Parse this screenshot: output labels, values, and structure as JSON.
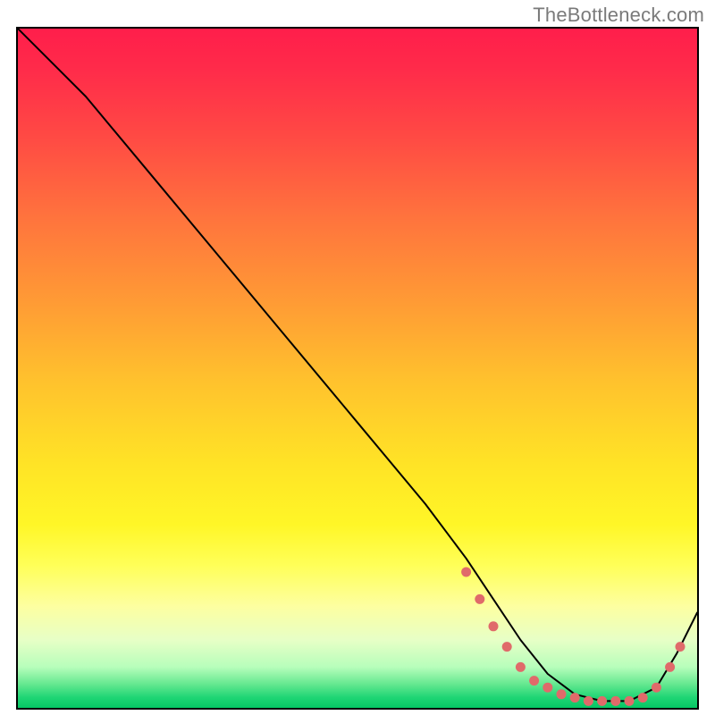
{
  "watermark": "TheBottleneck.com",
  "chart_data": {
    "type": "line",
    "title": "",
    "xlabel": "",
    "ylabel": "",
    "xlim": [
      0,
      100
    ],
    "ylim": [
      0,
      100
    ],
    "grid": false,
    "legend": false,
    "background_gradient": {
      "stops": [
        {
          "offset": 0.0,
          "color": "#ff1e4b"
        },
        {
          "offset": 0.06,
          "color": "#ff2b4a"
        },
        {
          "offset": 0.16,
          "color": "#ff4a44"
        },
        {
          "offset": 0.28,
          "color": "#ff743d"
        },
        {
          "offset": 0.4,
          "color": "#ff9a35"
        },
        {
          "offset": 0.52,
          "color": "#ffc22d"
        },
        {
          "offset": 0.64,
          "color": "#ffe326"
        },
        {
          "offset": 0.73,
          "color": "#fff627"
        },
        {
          "offset": 0.79,
          "color": "#ffff58"
        },
        {
          "offset": 0.85,
          "color": "#fdffa0"
        },
        {
          "offset": 0.9,
          "color": "#e7ffc6"
        },
        {
          "offset": 0.94,
          "color": "#b7febb"
        },
        {
          "offset": 0.965,
          "color": "#65e890"
        },
        {
          "offset": 0.985,
          "color": "#1ed574"
        },
        {
          "offset": 1.0,
          "color": "#06c765"
        }
      ]
    },
    "series": [
      {
        "name": "curve",
        "stroke": "#000000",
        "stroke_width": 2,
        "x": [
          0,
          6,
          10,
          20,
          30,
          40,
          50,
          60,
          66,
          70,
          74,
          78,
          82,
          86,
          90,
          94,
          97,
          100
        ],
        "y": [
          100,
          94,
          90,
          78,
          66,
          54,
          42,
          30,
          22,
          16,
          10,
          5,
          2,
          1,
          1,
          3,
          8,
          14
        ]
      }
    ],
    "markers": {
      "name": "optimal-range-dots",
      "color": "#e06a6a",
      "radius": 5.5,
      "x": [
        66,
        68,
        70,
        72,
        74,
        76,
        78,
        80,
        82,
        84,
        86,
        88,
        90,
        92,
        94,
        96,
        97.5
      ],
      "y": [
        20,
        16,
        12,
        9,
        6,
        4,
        3,
        2,
        1.5,
        1,
        1,
        1,
        1,
        1.5,
        3,
        6,
        9
      ]
    }
  }
}
